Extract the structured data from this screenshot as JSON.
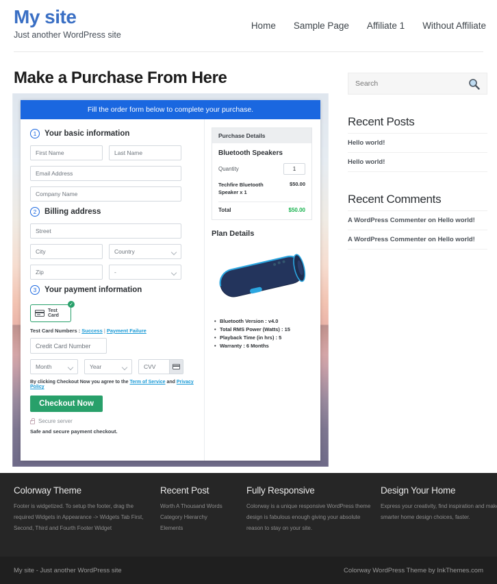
{
  "header": {
    "brand_title": "My site",
    "brand_tagline": "Just another WordPress site",
    "nav": [
      {
        "label": "Home"
      },
      {
        "label": "Sample Page"
      },
      {
        "label": "Affiliate 1"
      },
      {
        "label": "Without Affiliate"
      }
    ]
  },
  "main": {
    "page_title": "Make a Purchase From Here",
    "banner": "Fill the order form below to complete your purchase.",
    "steps": {
      "basic": {
        "num": "1",
        "label": "Your basic information"
      },
      "billing": {
        "num": "2",
        "label": "Billing address"
      },
      "payment": {
        "num": "3",
        "label": "Your payment information"
      }
    },
    "fields": {
      "first_name": "First Name",
      "last_name": "Last Name",
      "email": "Email Address",
      "company": "Company Name",
      "street": "Street",
      "city": "City",
      "country": "Country",
      "zip": "Zip",
      "state": "-",
      "credit_card": "Credit Card Number",
      "month": "Month",
      "year": "Year",
      "cvv": "CVV"
    },
    "payment": {
      "test_card_label": "Test  Card",
      "check_badge": "✓",
      "test_numbers_prefix": "Test Card Numbers : ",
      "test_numbers_success": "Success",
      "test_numbers_separator": " | ",
      "test_numbers_failure": "Payment Failure",
      "terms_prefix": "By clicking Checkout Now you agree to the ",
      "terms_tos": "Term of Service",
      "terms_and": " and ",
      "terms_privacy": "Privacy Policy",
      "checkout_button": "Checkout Now",
      "secure_server": "Secure server",
      "safe_note": "Safe and secure payment checkout."
    },
    "purchase_details": {
      "heading": "Purchase Details",
      "product": "Bluetooth Speakers",
      "quantity_label": "Quantity",
      "quantity_value": "1",
      "line_item_name": "Techfire Bluetooth Speaker x 1",
      "line_item_price": "$50.00",
      "total_label": "Total",
      "total_value": "$50.00"
    },
    "plan": {
      "title": "Plan Details",
      "specs": [
        "Bluetooth Version : v4.0",
        "Total RMS Power (Watts) : 15",
        "Playback Time (in hrs) : 5",
        "Warranty : 6 Months"
      ]
    }
  },
  "sidebar": {
    "search_placeholder": "Search",
    "recent_posts_title": "Recent Posts",
    "recent_posts": [
      "Hello world!",
      "Hello world!"
    ],
    "recent_comments_title": "Recent Comments",
    "recent_comments": [
      "A WordPress Commenter on Hello world!",
      "A WordPress Commenter on Hello world!"
    ]
  },
  "footer": {
    "columns": [
      {
        "title": "Colorway Theme",
        "text": "Footer is widgetized. To setup the footer, drag the required Widgets in Appearance -> Widgets Tab First, Second, Third and Fourth Footer Widget"
      },
      {
        "title": "Recent Post",
        "items": [
          "Worth A Thousand Words",
          "Category Hierarchy",
          "Elements"
        ]
      },
      {
        "title": "Fully Responsive",
        "text": "Colorway is a unique responsive WordPress theme design is fabulous enough giving your absolute reason to stay on your site."
      },
      {
        "title": "Design Your Home",
        "text": "Express your creativity, find inspiration and make smarter home design choices, faster."
      }
    ],
    "bottom_left": "My site - Just another WordPress site",
    "bottom_right": "Colorway WordPress Theme by InkThemes.com"
  }
}
